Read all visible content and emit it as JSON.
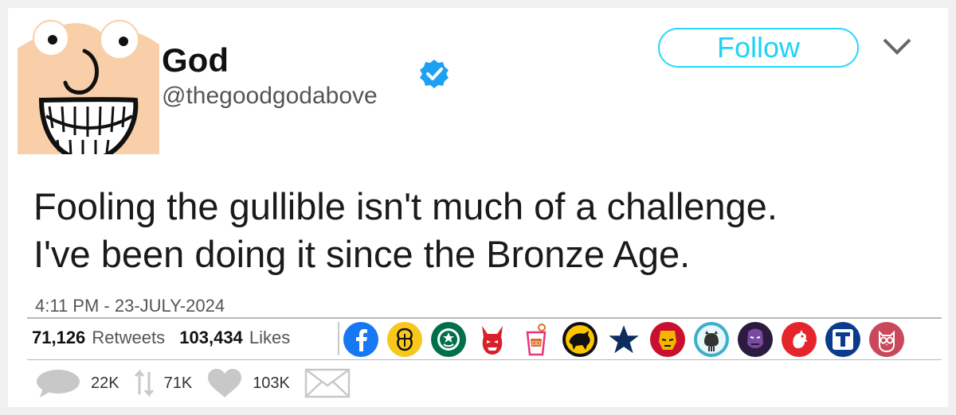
{
  "user": {
    "display_name": "God",
    "handle": "@thegoodgodabove"
  },
  "follow_label": "Follow",
  "tweet": {
    "lines": [
      "Fooling the gullible isn't much of a challenge.",
      "I've been doing it since the Bronze Age."
    ],
    "timestamp": "4:11 PM - 23-JULY-2024"
  },
  "stats": {
    "retweets_count": "71,126",
    "retweets_label": "Retweets",
    "likes_count": "103,434",
    "likes_label": "Likes"
  },
  "actions": {
    "replies": "22K",
    "retweets": "71K",
    "likes": "103K"
  },
  "logos": [
    "facebook-logo-icon",
    "bee-emblem-icon",
    "starbucks-logo-icon",
    "devil-mask-icon",
    "drink-cup-icon",
    "buffalo-wild-wings-icon",
    "dallas-star-icon",
    "iron-man-icon",
    "github-octocat-icon",
    "thanos-icon",
    "rooster-logo-icon",
    "t-logo-icon",
    "owl-logo-icon"
  ],
  "colors": {
    "follow_accent": "#1fd3f3",
    "verified": "#1da1f2",
    "avatar_skin": "#f8cfa8"
  }
}
